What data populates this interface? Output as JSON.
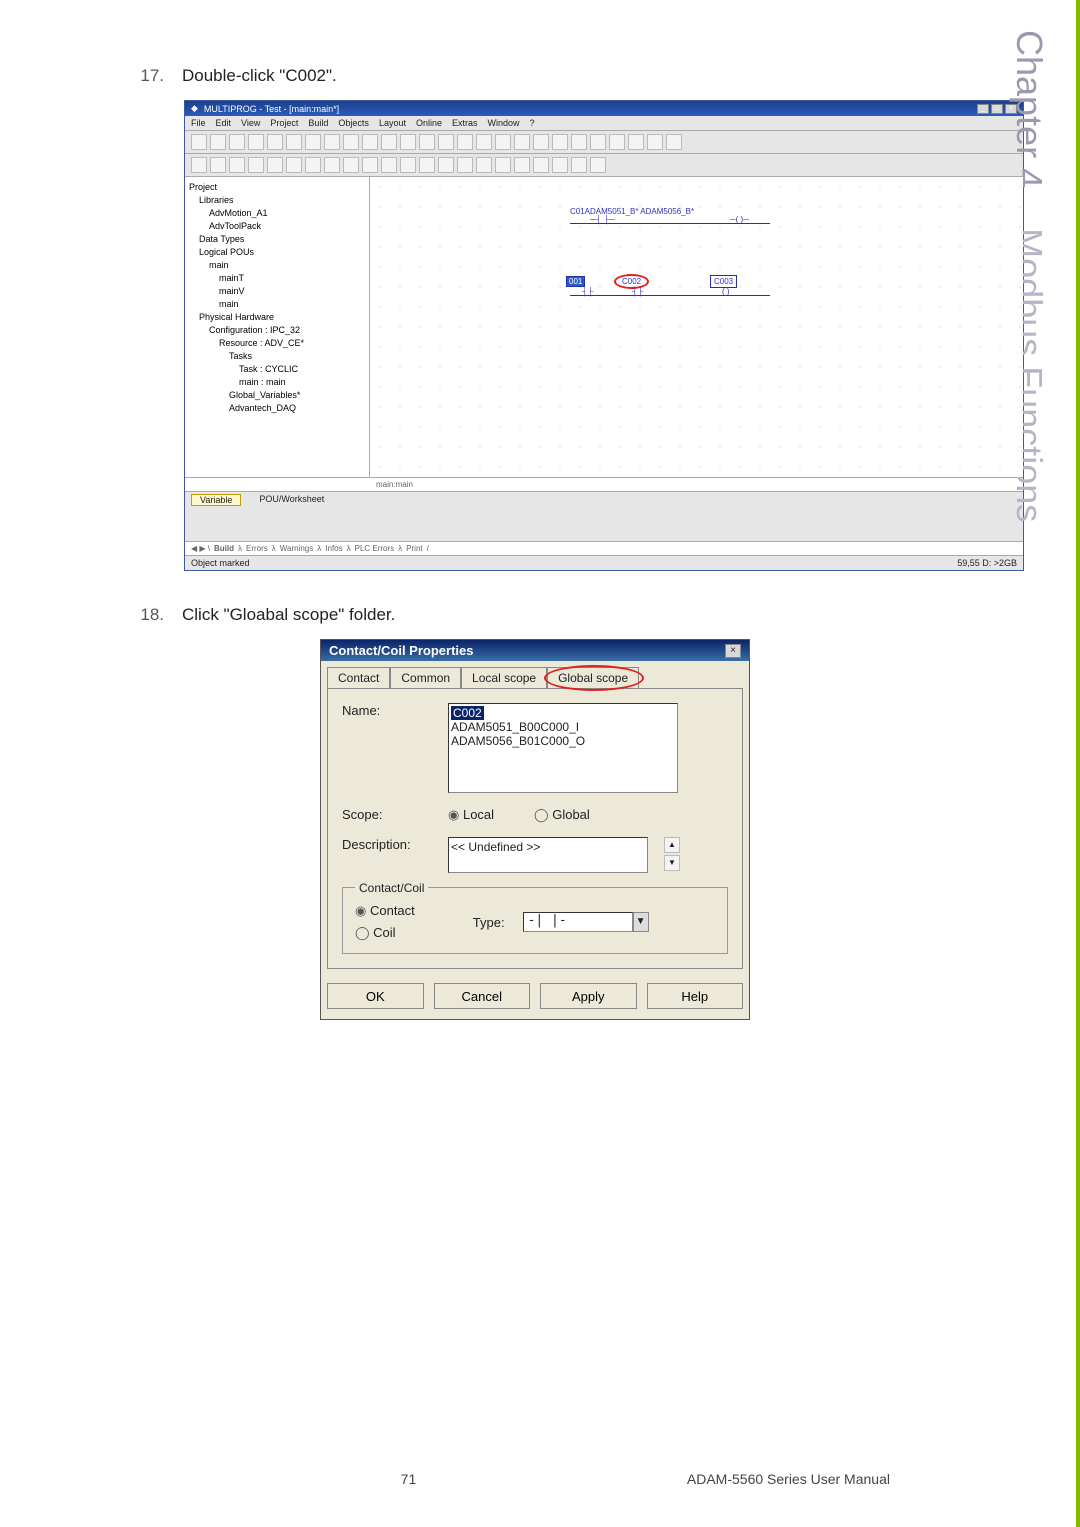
{
  "side_title": {
    "chapter": "Chapter 4",
    "name": "Modbus Functions"
  },
  "step17": {
    "num": "17.",
    "text": "Double-click \"C002\"."
  },
  "step18": {
    "num": "18.",
    "text": "Click \"Gloabal scope\" folder."
  },
  "mpw": {
    "title": "MULTIPROG - Test - [main:main*]",
    "menu": [
      "File",
      "Edit",
      "View",
      "Project",
      "Build",
      "Objects",
      "Layout",
      "Online",
      "Extras",
      "Window",
      "?"
    ],
    "tree": [
      "Project",
      "Libraries",
      "AdvMotion_A1",
      "AdvToolPack",
      "Data Types",
      "Logical POUs",
      "main",
      "mainT",
      "mainV",
      "main",
      "Physical Hardware",
      "Configuration : IPC_32",
      "Resource : ADV_CE*",
      "Tasks",
      "Task : CYCLIC",
      "main : main",
      "Global_Variables*",
      "Advantech_DAQ"
    ],
    "canvas": {
      "net_label": "C01ADAM5051_B*   ADAM5056_B*",
      "c001": "001",
      "c002": "C002",
      "c003": "C003"
    },
    "tab_label": "main:main",
    "var_label": "Variable",
    "pou_label": "POU/Worksheet",
    "bottom_tabs": [
      "Build",
      "Errors",
      "Warnings",
      "Infos",
      "PLC Errors",
      "Print"
    ],
    "status_left": "Object marked",
    "status_right": "59,55  D: >2GB"
  },
  "dlg": {
    "title": "Contact/Coil Properties",
    "tabs": [
      "Contact",
      "Common",
      "Local scope",
      "Global scope"
    ],
    "name_lbl": "Name:",
    "name_sel": "C002",
    "name_opts": [
      "ADAM5051_B00C000_I",
      "ADAM5056_B01C000_O"
    ],
    "scope_lbl": "Scope:",
    "scope_local": "Local",
    "scope_global": "Global",
    "desc_lbl": "Description:",
    "desc_val": "<< Undefined >>",
    "fs_legend": "Contact/Coil",
    "fs_contact": "Contact",
    "fs_coil": "Coil",
    "type_lbl": "Type:",
    "type_val": "-| |-",
    "btns": [
      "OK",
      "Cancel",
      "Apply",
      "Help"
    ]
  },
  "footer": {
    "page": "71",
    "manual": "ADAM-5560 Series User Manual"
  }
}
